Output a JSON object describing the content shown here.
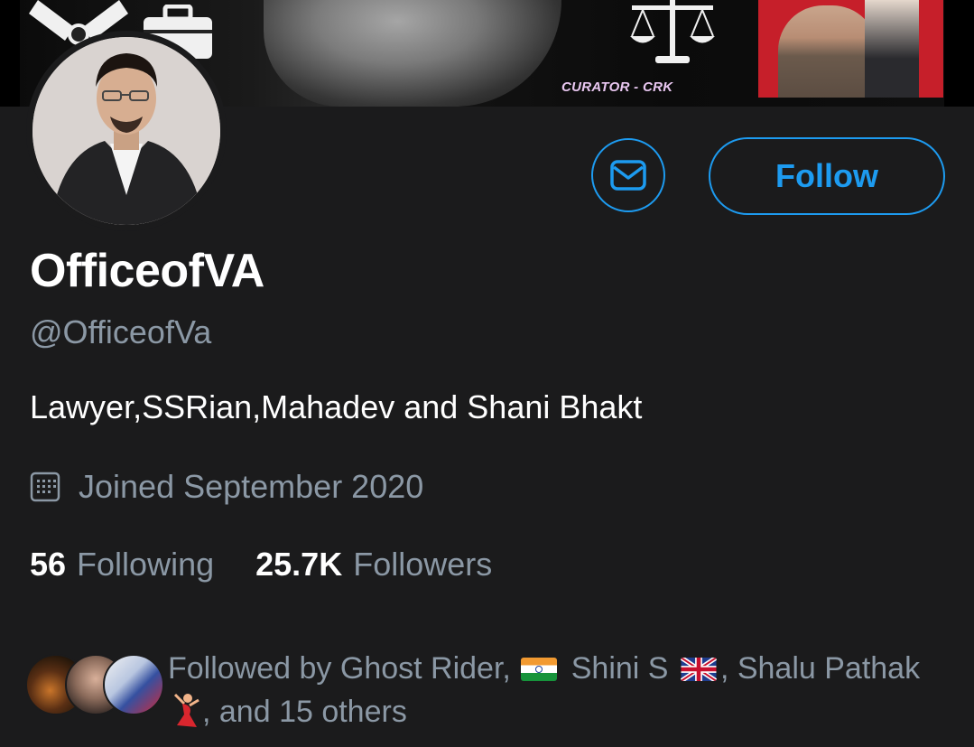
{
  "banner": {
    "curator_text": "CURATOR - CRK"
  },
  "profile": {
    "display_name": "OfficeofVA",
    "handle": "@OfficeofVa",
    "bio": "Lawyer,SSRian,Mahadev and Shani Bhakt",
    "joined": "Joined September 2020",
    "following_count": "56",
    "following_label": "Following",
    "followers_count": "25.7K",
    "followers_label": "Followers"
  },
  "actions": {
    "follow_label": "Follow",
    "message_icon": "mail-icon"
  },
  "followed_by": {
    "prefix": "Followed by Ghost Rider,",
    "name2": "Shini S",
    "name3": ", Shalu Pathak",
    "suffix": ", and 15 others"
  },
  "colors": {
    "accent": "#1d9bf0",
    "background": "#1b1b1c",
    "secondary_text": "#8b98a5"
  }
}
